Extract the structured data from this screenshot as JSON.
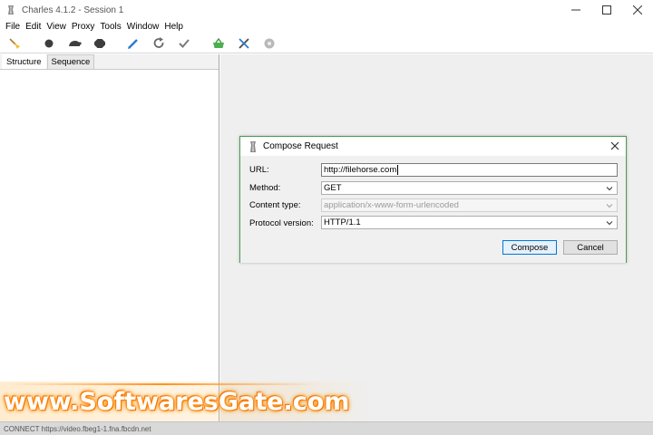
{
  "window": {
    "title": "Charles 4.1.2 - Session 1"
  },
  "menu": {
    "items": [
      "File",
      "Edit",
      "View",
      "Proxy",
      "Tools",
      "Window",
      "Help"
    ]
  },
  "toolbar": {
    "buttons": [
      "broom-icon",
      "record-icon",
      "throttle-icon",
      "breakpoint-icon",
      "compose-icon",
      "repeat-icon",
      "validate-icon",
      "basket-icon",
      "tools-icon",
      "settings-icon"
    ]
  },
  "left_pane": {
    "tabs": [
      "Structure",
      "Sequence"
    ],
    "active_tab": "Structure"
  },
  "status_bar": {
    "text": "CONNECT https://video.fbeg1-1.fna.fbcdn.net"
  },
  "dialog": {
    "title": "Compose Request",
    "url_label": "URL:",
    "url_value": "http://filehorse.com",
    "method_label": "Method:",
    "method_value": "GET",
    "content_type_label": "Content type:",
    "content_type_value": "application/x-www-form-urlencoded",
    "protocol_label": "Protocol version:",
    "protocol_value": "HTTP/1.1",
    "compose_label": "Compose",
    "cancel_label": "Cancel"
  },
  "watermark": {
    "text": "www.SoftwaresGate.com"
  },
  "colors": {
    "dialog_border": "#4f9a56",
    "primary_button_border": "#0078d7",
    "watermark_glow": "#ff8000"
  }
}
